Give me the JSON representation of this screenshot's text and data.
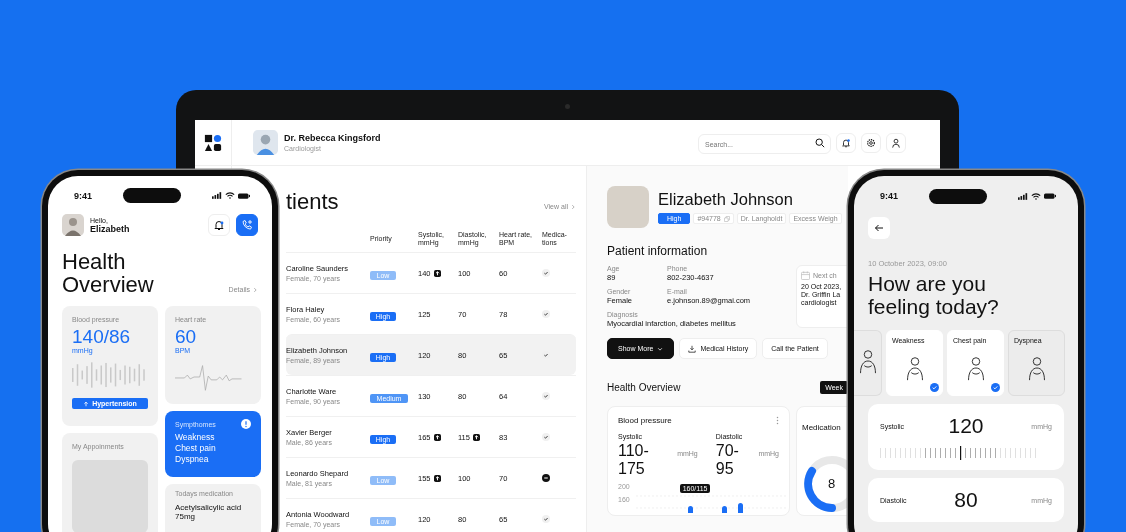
{
  "laptop": {
    "doctor": {
      "name": "Dr. Rebecca Kingsford",
      "role": "Cardiologist"
    },
    "search": {
      "placeholder": "Search..."
    },
    "patients": {
      "title": "tients",
      "view_all": "View all",
      "columns": [
        "Priority",
        "Systolic,\nmmHg",
        "Diastolic,\nmmHg",
        "Heart rate,\nBPM",
        "Medica-\ntions"
      ],
      "rows": [
        {
          "name": "Caroline Saunders",
          "info": "Female, 70 years",
          "priority": {
            "label": "Low",
            "kind": "low"
          },
          "systolic": "140",
          "systolic_high": true,
          "diastolic": "100",
          "diastolic_high": false,
          "heart_rate": "60",
          "medication": {
            "kind": "taken"
          },
          "selected": false
        },
        {
          "name": "Flora Haley",
          "info": "Female, 60 years",
          "priority": {
            "label": "High",
            "kind": "high"
          },
          "systolic": "125",
          "systolic_high": false,
          "diastolic": "70",
          "diastolic_high": false,
          "heart_rate": "78",
          "medication": {
            "kind": "taken"
          },
          "selected": false
        },
        {
          "name": "Elizabeth Johnson",
          "info": "Female, 89 years",
          "priority": {
            "label": "High",
            "kind": "high"
          },
          "systolic": "120",
          "systolic_high": false,
          "diastolic": "80",
          "diastolic_high": false,
          "heart_rate": "65",
          "medication": {
            "kind": "taken"
          },
          "selected": true
        },
        {
          "name": "Charlotte Ware",
          "info": "Female, 90 years",
          "priority": {
            "label": "Medium",
            "kind": "medium"
          },
          "systolic": "130",
          "systolic_high": false,
          "diastolic": "80",
          "diastolic_high": false,
          "heart_rate": "64",
          "medication": {
            "kind": "taken"
          },
          "selected": false
        },
        {
          "name": "Xavier Berger",
          "info": "Male, 86 years",
          "priority": {
            "label": "High",
            "kind": "high"
          },
          "systolic": "165",
          "systolic_high": true,
          "diastolic": "115",
          "diastolic_high": true,
          "heart_rate": "83",
          "medication": {
            "kind": "taken"
          },
          "selected": false
        },
        {
          "name": "Leonardo Shepard",
          "info": "Male, 81 years",
          "priority": {
            "label": "Low",
            "kind": "low"
          },
          "systolic": "155",
          "systolic_high": true,
          "diastolic": "100",
          "diastolic_high": false,
          "heart_rate": "70",
          "medication": {
            "kind": "missed"
          },
          "selected": false
        },
        {
          "name": "Antonia Woodward",
          "info": "Female, 70 years",
          "priority": {
            "label": "Low",
            "kind": "low"
          },
          "systolic": "120",
          "systolic_high": false,
          "diastolic": "80",
          "diastolic_high": false,
          "heart_rate": "65",
          "medication": {
            "kind": "taken"
          },
          "selected": false
        }
      ]
    },
    "patient": {
      "name": "Elizabeth Johnson",
      "tags": [
        {
          "label": "High",
          "kind": "priority"
        },
        {
          "label": "#94778",
          "kind": "copy"
        },
        {
          "label": "Dr. Langholdt",
          "kind": "plain"
        },
        {
          "label": "Excess Weigh",
          "kind": "plain"
        }
      ],
      "info_title": "Patient information",
      "fields": [
        {
          "label": "Age",
          "value": "89"
        },
        {
          "label": "Phone",
          "value": "802-230-4637"
        },
        {
          "label": "Gender",
          "value": "Female"
        },
        {
          "label": "E-mail",
          "value": "e.johnson.89@gmai.com"
        },
        {
          "label": "Diagnosis",
          "value": "Myocardial infarction, diabetes mellitus"
        }
      ],
      "next_checkup": {
        "label": "Next ch",
        "lines": [
          "20 Oct 2023,",
          "Dr. Griffin La",
          "cardiologist"
        ]
      },
      "buttons": [
        {
          "label": "Show More",
          "kind": "primary"
        },
        {
          "label": "Medical History",
          "kind": "download"
        },
        {
          "label": "Call the Patient",
          "kind": "plain"
        }
      ],
      "overview_title": "Health Overview",
      "period": "Week",
      "blood_pressure": {
        "title": "Blood pressure",
        "readings": [
          {
            "label": "Systolic",
            "value": "110-175",
            "unit": "mmHg"
          },
          {
            "label": "Diastolic",
            "value": "70-95",
            "unit": "mmHg"
          }
        ],
        "axis_labels": [
          "200",
          "160"
        ],
        "tooltip": "160/115"
      },
      "medication": {
        "title": "Medication",
        "value": "8"
      }
    }
  },
  "phone_left": {
    "time": "9:41",
    "greeting": "Hello,",
    "user": "Elizabeth",
    "title": "Health Overview",
    "details_link": "Details",
    "blood_pressure": {
      "label": "Blood pressure",
      "value": "140/86",
      "unit": "mmHg",
      "status": "Hypertension"
    },
    "heart_rate": {
      "label": "Heart rate",
      "value": "60",
      "unit": "BPM"
    },
    "symptoms": {
      "label": "Sympthomes",
      "items": [
        "Weakness",
        "Chest pain",
        "Dyspnea"
      ]
    },
    "appointments": {
      "label": "My Appoinments"
    },
    "medication": {
      "label": "Todays medication",
      "name": "Acetylsalicylic acid 75mg"
    }
  },
  "phone_right": {
    "time": "9:41",
    "date": "10 October 2023, 09:00",
    "question": "How are you feeling today?",
    "symptoms": [
      {
        "checked": false
      },
      {
        "label": "Weakness",
        "checked": true
      },
      {
        "label": "Chest pain",
        "checked": true
      },
      {
        "label": "Dyspnea",
        "checked": false
      }
    ],
    "measurements": [
      {
        "label": "Systolic",
        "value": "120",
        "unit": "mmHg"
      },
      {
        "label": "Diastolic",
        "value": "80",
        "unit": "mmHg"
      }
    ]
  }
}
